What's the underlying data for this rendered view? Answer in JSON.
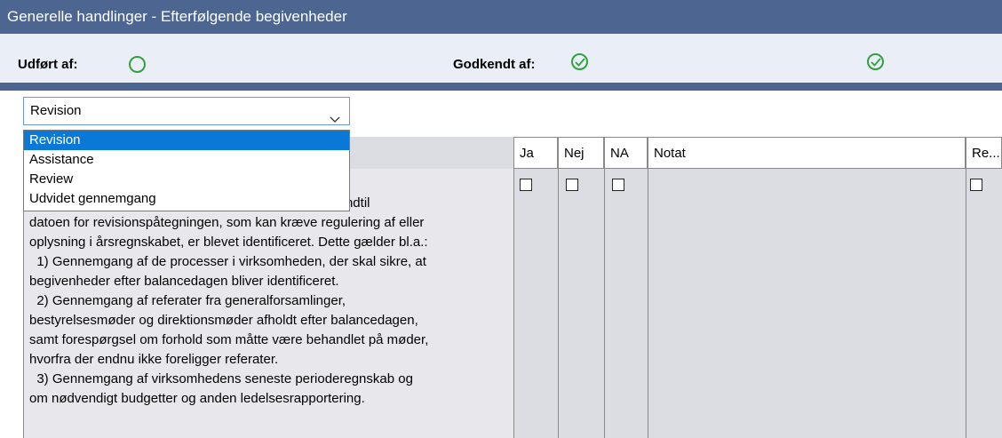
{
  "window": {
    "title": "Generelle handlinger - Efterfølgende begivenheder"
  },
  "status": {
    "performed_label": "Udført af:",
    "approved_label": "Godkendt af:",
    "colors": {
      "ok": "#2fa23c",
      "header": "#4d6591"
    }
  },
  "select": {
    "value": "Revision",
    "options": [
      "Revision",
      "Assistance",
      "Review",
      "Udvidet gennemgang"
    ]
  },
  "table": {
    "headers": {
      "ja": "Ja",
      "nej": "Nej",
      "na": "NA",
      "notat": "Notat",
      "re": "Re..."
    },
    "row_text": "                                                formål at opnå\n                                                          le begivenheder indtil\ndatoen for revisionspåtegningen, som kan kræve regulering af eller\noplysning i årsregnskabet, er blevet identificeret. Dette gælder bl.a.:\n  1) Gennemgang af de processer i virksomheden, der skal sikre, at\nbegivenheder efter balancedagen bliver identificeret.\n  2) Gennemgang af referater fra generalforsamlinger,\nbestyrelsesmøder og direktionsmøder afholdt efter balancedagen,\nsamt forespørgsel om forhold som måtte være behandlet på møder,\nhvorfra der endnu ikke foreligger referater.\n  3) Gennemgang af virksomhedens seneste perioderegnskab og\nom nødvendigt budgetter og anden ledelsesrapportering."
  }
}
